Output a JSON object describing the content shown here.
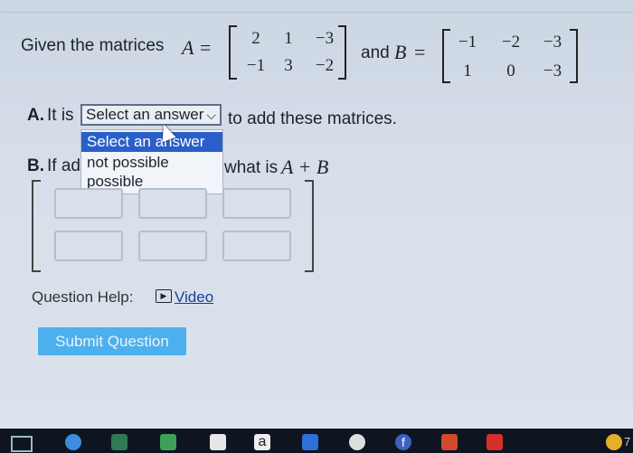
{
  "question": {
    "intro": "Given the matrices",
    "and_text": "and",
    "matrix_a_name": "A",
    "matrix_b_name": "B",
    "equals": "=",
    "matrix_a": [
      [
        "2",
        "1",
        "−3"
      ],
      [
        "−1",
        "3",
        "−2"
      ]
    ],
    "matrix_b": [
      [
        "−1",
        "−2",
        "−3"
      ],
      [
        "1",
        "0",
        "−3"
      ]
    ]
  },
  "part_a": {
    "label": "A.",
    "prefix": "It is",
    "select_value": "Select an answer",
    "suffix": "to add these matrices."
  },
  "dropdown": {
    "options": [
      "Select an answer",
      "not possible",
      "possible"
    ]
  },
  "part_b": {
    "label": "B.",
    "prefix": "If ad",
    "suffix": "what is",
    "expr": "A + B"
  },
  "help": {
    "label": "Question Help:",
    "video": "Video"
  },
  "submit_label": "Submit Question",
  "taskbar": {
    "icons": [
      "chrome-icon",
      "files-icon",
      "sheets-icon",
      "gmail-icon",
      "amazon-icon",
      "dropbox-icon",
      "camera-icon",
      "facebook-icon",
      "office-icon",
      "youtube-icon"
    ],
    "amazon_letter": "a",
    "facebook_letter": "f",
    "clock_partial": "7"
  }
}
